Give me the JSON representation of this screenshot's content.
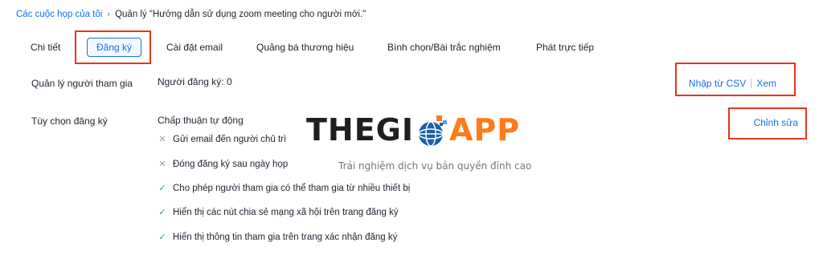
{
  "breadcrumb": {
    "root": "Các cuộc họp của tôi",
    "separator": "›",
    "current": "Quản lý \"Hướng dẫn sử dụng zoom meeting cho người mới.\""
  },
  "tabs": [
    {
      "label": "Chi tiết",
      "active": false
    },
    {
      "label": "Đăng ký",
      "active": true
    },
    {
      "label": "Cài đặt email",
      "active": false
    },
    {
      "label": "Quảng bá thương hiệu",
      "active": false
    },
    {
      "label": "Bình chọn/Bài trắc nghiệm",
      "active": false
    },
    {
      "label": "Phát trực tiếp",
      "active": false
    }
  ],
  "manage_participants": {
    "label": "Quản lý người tham gia",
    "registrants": "Người đăng ký: 0",
    "import_csv": "Nhập từ CSV",
    "view": "Xem"
  },
  "registration_options": {
    "label": "Tùy chọn đăng ký",
    "approval": "Chấp thuận tự động",
    "edit": "Chỉnh sửa",
    "items": [
      {
        "text": "Gửi email đến người chủ trì",
        "enabled": false
      },
      {
        "text": "Đóng đăng ký sau ngày họp",
        "enabled": false
      },
      {
        "text": "Cho phép người tham gia có thể tham gia từ nhiều thiết bị",
        "enabled": true
      },
      {
        "text": "Hiển thị các nút chia sẻ mạng xã hội trên trang đăng ký",
        "enabled": true
      },
      {
        "text": "Hiển thị thông tin tham gia trên trang xác nhận đăng ký",
        "enabled": true
      }
    ]
  },
  "watermark": {
    "brand_left": "THEGI",
    "brand_right": "APP",
    "tagline": "Trải nghiệm dịch vụ bản quyền đỉnh cao"
  },
  "colors": {
    "link": "#0e72ed",
    "highlight_box": "#e8331f",
    "check": "#23a55a",
    "cross": "#9aa0a6"
  },
  "icons": {
    "disabled_option": "x-icon",
    "enabled_option": "check-icon",
    "breadcrumb_separator": "chevron-right-icon"
  }
}
